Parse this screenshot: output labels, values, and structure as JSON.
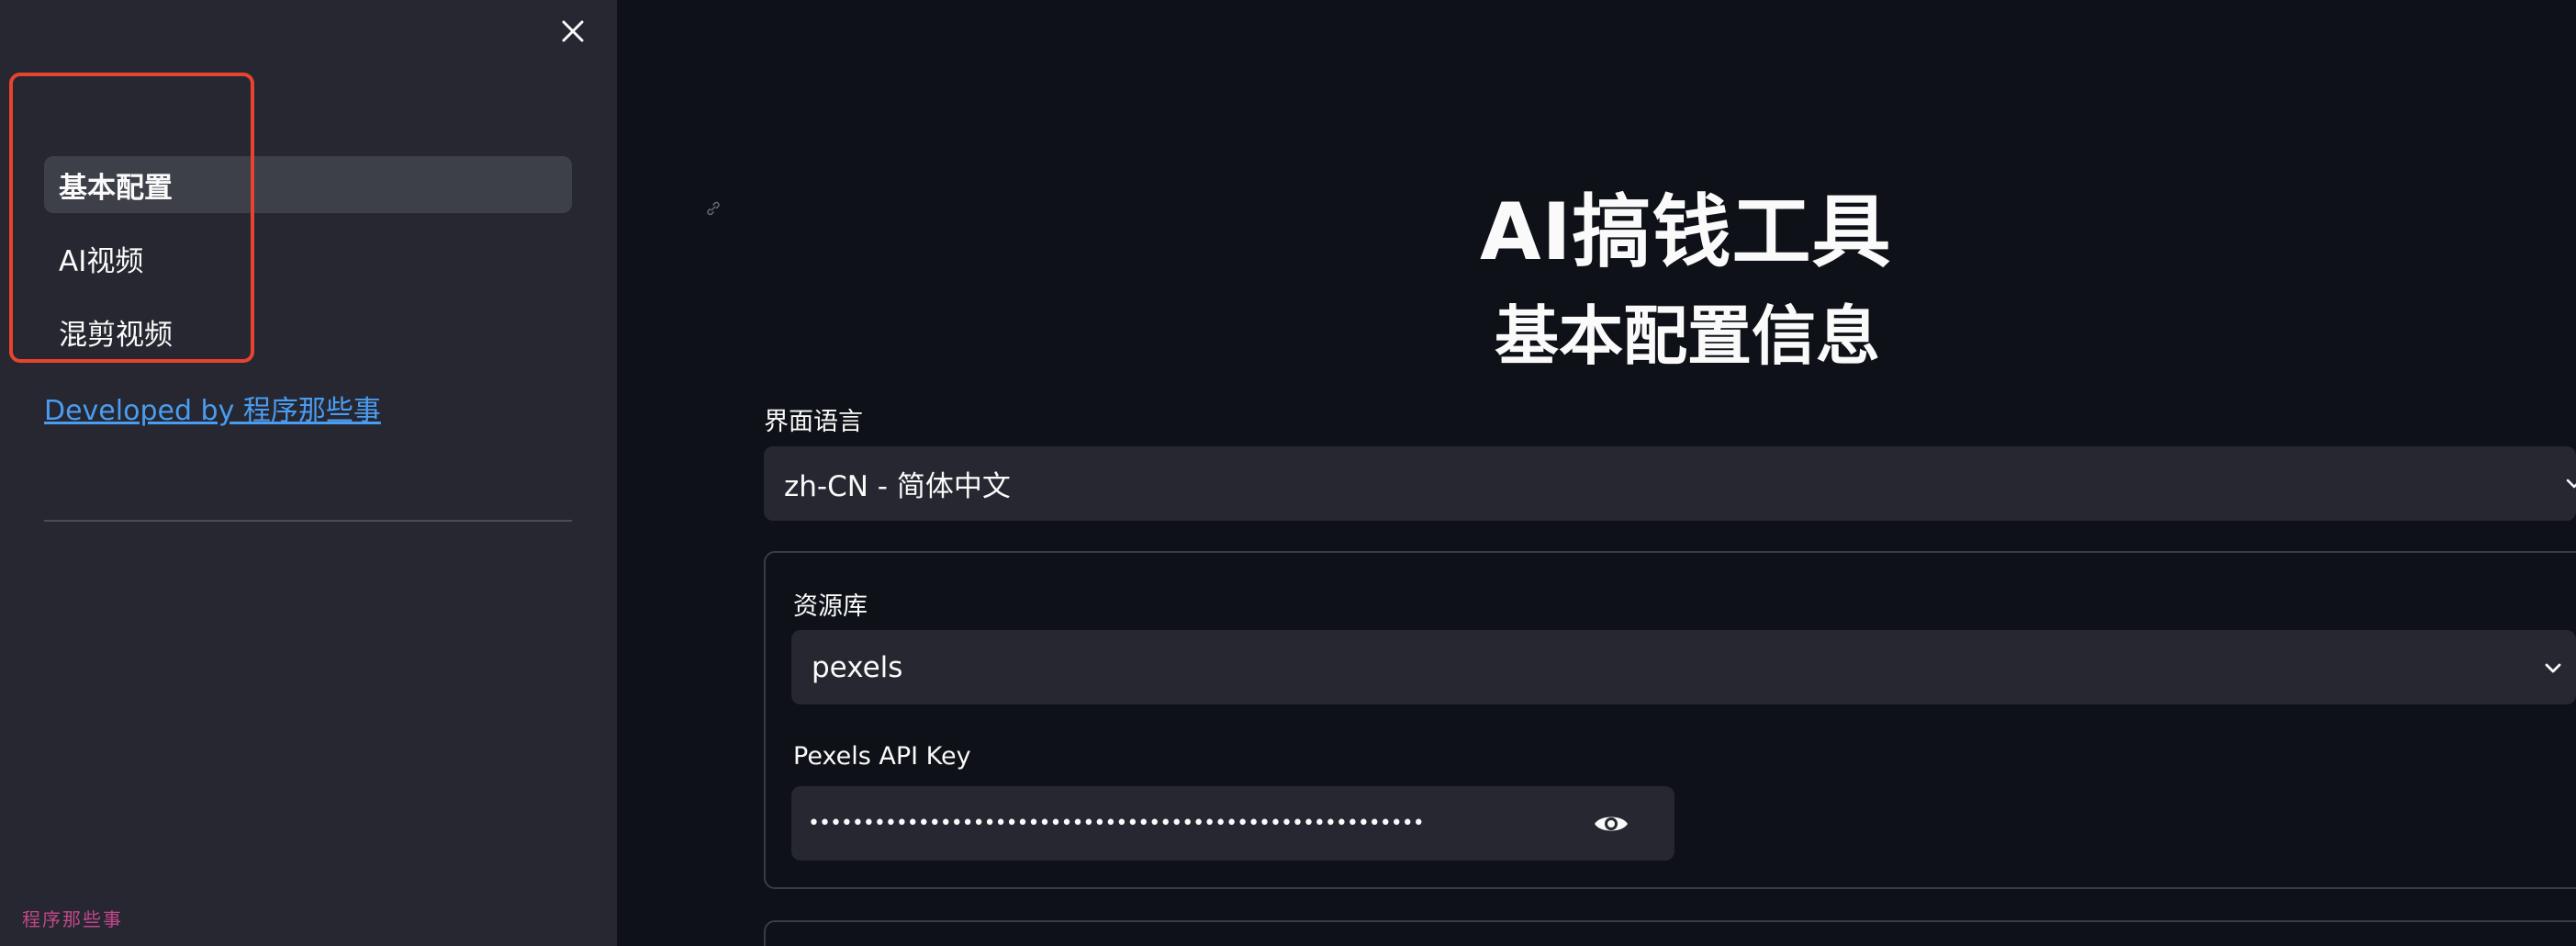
{
  "sidebar": {
    "close_icon": "close-icon",
    "nav_items": [
      {
        "label": "基本配置",
        "active": true
      },
      {
        "label": "AI视频",
        "active": false
      },
      {
        "label": "混剪视频",
        "active": false
      }
    ],
    "dev_link": "Developed by 程序那些事",
    "watermark": "程序那些事"
  },
  "main": {
    "title": "AI搞钱工具",
    "subtitle": "基本配置信息",
    "language": {
      "label": "界面语言",
      "value": "zh-CN - 简体中文"
    },
    "resource": {
      "label": "资源库",
      "value": "pexels",
      "api_key_label": "Pexels API Key",
      "api_key_value": "••••••••••••••••••••••••••••••••••••••••••••••••••••••••"
    }
  },
  "colors": {
    "accent_highlight": "#e8432e",
    "link": "#4a9cf0",
    "sidebar_bg": "#262730",
    "main_bg": "#0e1117"
  }
}
